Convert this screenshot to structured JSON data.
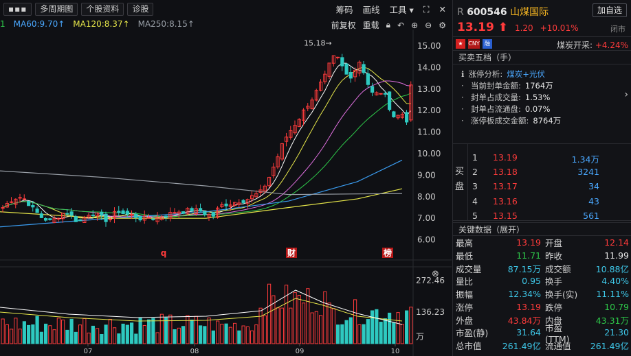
{
  "toolbar": {
    "menu_label": "▪▪▪",
    "period_label": "多周期图",
    "profile_label": "个股资料",
    "diagnose_label": "诊股",
    "chips_label": "筹码",
    "draw_label": "画线",
    "tools_label": "工具",
    "adjust_label": "前复权",
    "overlay_label": "重载"
  },
  "ma": {
    "lead": "1",
    "ma60": "MA60:9.70↑",
    "ma120": "MA120:8.37↑",
    "ma250": "MA250:8.15↑"
  },
  "price_axis": [
    "15.00",
    "14.00",
    "13.00",
    "12.00",
    "11.00",
    "10.00",
    "9.00",
    "8.00",
    "7.00",
    "6.00"
  ],
  "high_marker": "15.18→",
  "event_markers": [
    "q",
    "财",
    "榜"
  ],
  "volume_axis": [
    "272.46",
    "136.23",
    "万"
  ],
  "month_labels": [
    "07",
    "08",
    "09",
    "10"
  ],
  "stock": {
    "prefix": "R",
    "code": "600546",
    "name": "山煤国际",
    "add_label": "加自选",
    "price": "13.19",
    "change": "1.20",
    "change_pct": "+10.01%",
    "status": "闭市",
    "sector": "煤炭开采:",
    "sector_pct": "+4.24%"
  },
  "tags": [
    "CN",
    "CNY",
    "融"
  ],
  "orderbook_title": "买卖五档（手）",
  "limit": {
    "analysis_label": "涨停分析:",
    "analysis_value": "煤炭+光伏",
    "lines": [
      {
        "label": "当前封单金额:",
        "value": "1764万"
      },
      {
        "label": "封单占成交量:",
        "value": "1.53%"
      },
      {
        "label": "封单占流通盘:",
        "value": "0.07%"
      },
      {
        "label": "涨停板成交金额:",
        "value": "8764万"
      }
    ]
  },
  "bid": {
    "label": "买盘",
    "rows": [
      {
        "i": "1",
        "p": "13.19",
        "q": "1.34万"
      },
      {
        "i": "2",
        "p": "13.18",
        "q": "3241"
      },
      {
        "i": "3",
        "p": "13.17",
        "q": "34"
      },
      {
        "i": "4",
        "p": "13.16",
        "q": "43"
      },
      {
        "i": "5",
        "p": "13.15",
        "q": "561"
      }
    ]
  },
  "key_title": "关键数据（展开）",
  "key": [
    {
      "l": "最高",
      "v": "13.19",
      "c": "red",
      "l2": "开盘",
      "v2": "12.14",
      "c2": "red"
    },
    {
      "l": "最低",
      "v": "11.71",
      "c": "green",
      "l2": "昨收",
      "v2": "11.99",
      "c2": "wht"
    },
    {
      "l": "成交量",
      "v": "87.15万",
      "c": "cyan",
      "l2": "成交额",
      "v2": "10.88亿",
      "c2": "cyan"
    },
    {
      "l": "量比",
      "v": "0.95",
      "c": "cyan",
      "l2": "换手",
      "v2": "4.40%",
      "c2": "cyan"
    },
    {
      "l": "振幅",
      "v": "12.34%",
      "c": "cyan",
      "l2": "换手(实)",
      "v2": "11.11%",
      "c2": "cyan"
    },
    {
      "l": "涨停",
      "v": "13.19",
      "c": "red",
      "l2": "跌停",
      "v2": "10.79",
      "c2": "green"
    },
    {
      "l": "外盘",
      "v": "43.84万",
      "c": "red",
      "l2": "内盘",
      "v2": "43.31万",
      "c2": "green"
    },
    {
      "l": "市盈(静)",
      "v": "31.64",
      "c": "cyan",
      "l2": "市盈(TTM)",
      "v2": "21.30",
      "c2": "cyan"
    },
    {
      "l": "总市值",
      "v": "261.49亿",
      "c": "cyan",
      "l2": "流通值",
      "v2": "261.49亿",
      "c2": "cyan"
    }
  ]
}
